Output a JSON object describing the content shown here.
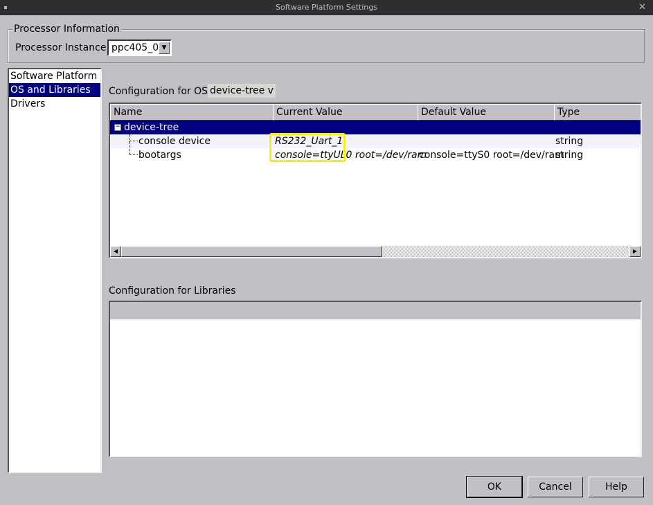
{
  "window": {
    "title": "Software Platform Settings",
    "close": "✕"
  },
  "processor": {
    "group_title": "Processor Information",
    "label": "Processor Instance:",
    "value": "ppc405_0"
  },
  "nav": {
    "items": [
      {
        "label": "Software Platform"
      },
      {
        "label": "OS and Libraries",
        "selected": true
      },
      {
        "label": "Drivers"
      }
    ]
  },
  "os": {
    "label": "Configuration for OS:",
    "value": "device-tree v",
    "columns": [
      "Name",
      "Current Value",
      "Default Value",
      "Type"
    ],
    "root": "device-tree",
    "rows": [
      {
        "name": "console device",
        "current": "RS232_Uart_1",
        "default": "",
        "type": "string"
      },
      {
        "name": "bootargs",
        "current": "console=ttyUL0 root=/dev/ram",
        "default": "console=ttyS0 root=/dev/ram",
        "type": "string"
      }
    ]
  },
  "libraries": {
    "label": "Configuration for Libraries"
  },
  "buttons": {
    "ok": "OK",
    "cancel": "Cancel",
    "help": "Help"
  },
  "colors": {
    "selection": "#000080",
    "highlight": "#f5ee1a"
  }
}
